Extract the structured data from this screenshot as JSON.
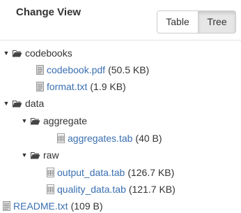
{
  "header": {
    "title": "Change View",
    "table_label": "Table",
    "tree_label": "Tree"
  },
  "tree": {
    "codebooks": {
      "name": "codebooks",
      "files": [
        {
          "name": "codebook.pdf",
          "size": "(50.5 KB)"
        },
        {
          "name": "format.txt",
          "size": "(1.9 KB)"
        }
      ]
    },
    "data": {
      "name": "data",
      "aggregate": {
        "name": "aggregate",
        "files": [
          {
            "name": "aggregates.tab",
            "size": "(40 B)"
          }
        ]
      },
      "raw": {
        "name": "raw",
        "files": [
          {
            "name": "output_data.tab",
            "size": "(126.7 KB)"
          },
          {
            "name": "quality_data.tab",
            "size": "(121.7 KB)"
          }
        ]
      }
    },
    "root_files": [
      {
        "name": "README.txt",
        "size": "(109 B)"
      }
    ]
  }
}
